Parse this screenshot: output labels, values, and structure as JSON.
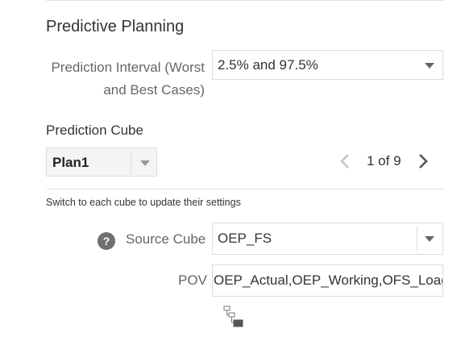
{
  "section": {
    "title": "Predictive Planning"
  },
  "prediction_interval": {
    "label": "Prediction Interval (Worst and Best Cases)",
    "label_line1": "Prediction Interval (Worst",
    "label_line2": "and Best Cases)",
    "value": "2.5% and 97.5%"
  },
  "prediction_cube": {
    "label": "Prediction Cube",
    "value": "Plan1",
    "pager": {
      "text": "1 of 9"
    }
  },
  "hint": "Switch to each cube to update their settings",
  "source_cube": {
    "label": "Source Cube",
    "value": "OEP_FS"
  },
  "pov": {
    "label": "POV",
    "value": "OEP_Actual,OEP_Working,OFS_Load"
  },
  "icons": {
    "help": "help-circle-icon",
    "prev": "chevron-left-icon",
    "next": "chevron-right-icon",
    "member_selector": "member-selector-icon"
  },
  "colors": {
    "text": "#333333",
    "label_muted": "#666666",
    "border": "#dcdcdc",
    "divider": "#e3e3e3",
    "cube_bg": "#f4f4f4"
  }
}
